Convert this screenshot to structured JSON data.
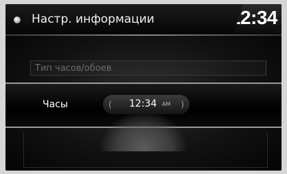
{
  "header": {
    "title": "Настр. информации",
    "clock": "12:34",
    "icon": "disc-icon"
  },
  "list": {
    "items": [
      {
        "label": "Тип часов/обоев"
      }
    ]
  },
  "selected": {
    "label": "Часы",
    "time": "12:34",
    "ampm": "AM",
    "left_arrow": "(",
    "right_arrow": ")"
  },
  "colors": {
    "background": "#000000",
    "text": "#ffffff",
    "dim_text": "#6d6d6d",
    "frame": "#d6d6d6"
  }
}
